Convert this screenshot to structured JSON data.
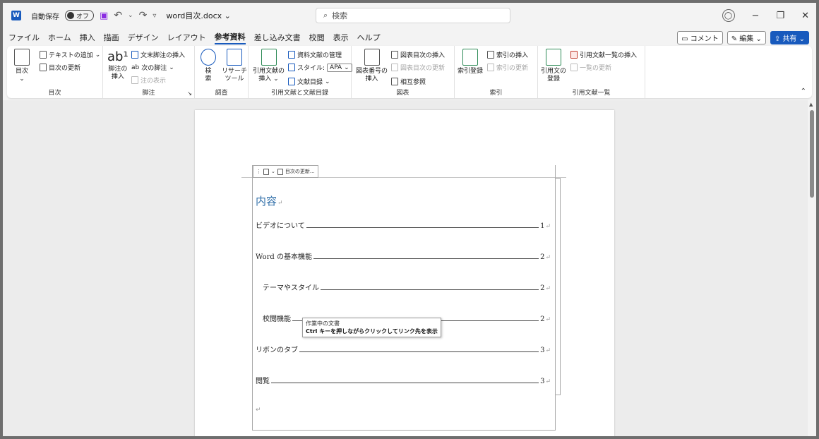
{
  "titlebar": {
    "app_icon": "word-icon",
    "autosave_label": "自動保存",
    "autosave_state": "オフ",
    "doc_title": "word目次.docx",
    "search_placeholder": "検索",
    "minimize_glyph": "−",
    "restore_glyph": "❐",
    "close_glyph": "✕"
  },
  "menu": {
    "tabs": [
      "ファイル",
      "ホーム",
      "挿入",
      "描画",
      "デザイン",
      "レイアウト",
      "参考資料",
      "差し込み文書",
      "校閲",
      "表示",
      "ヘルプ"
    ],
    "active_tab": "参考資料",
    "comment_label": "コメント",
    "edit_label": "編集",
    "share_label": "共有"
  },
  "ribbon": {
    "toc": {
      "big_label": "目次",
      "add_text": "テキストの追加",
      "update_toc": "目次の更新",
      "group": "目次"
    },
    "footnote": {
      "big_label_1": "脚注の",
      "big_label_2": "挿入",
      "endnote": "文末脚注の挿入",
      "next_footnote": "次の脚注",
      "show_notes": "注の表示",
      "group": "脚注"
    },
    "research": {
      "search_1": "検",
      "search_2": "索",
      "researcher_1": "リサーチ",
      "researcher_2": "ツール",
      "group": "調査"
    },
    "citations": {
      "big_label_1": "引用文献の",
      "big_label_2": "挿入",
      "manage_sources": "資料文献の管理",
      "style_label": "スタイル:",
      "style_value": "APA",
      "bibliography": "文献目録",
      "group": "引用文献と文献目録"
    },
    "captions": {
      "big_label_1": "図表番号の",
      "big_label_2": "挿入",
      "insert_tof": "図表目次の挿入",
      "update_tof": "図表目次の更新",
      "cross_ref": "相互参照",
      "group": "図表"
    },
    "index": {
      "big_label": "索引登録",
      "insert_index": "索引の挿入",
      "update_index": "索引の更新",
      "group": "索引"
    },
    "authorities": {
      "big_label_1": "引用文の",
      "big_label_2": "登録",
      "insert_toa": "引用文献一覧の挿入",
      "update_toa": "一覧の更新",
      "group": "引用文献一覧"
    }
  },
  "document": {
    "toc_tab_label": "目次の更新...",
    "heading": "内容",
    "entries": [
      {
        "text": "ビデオについて",
        "page": "1"
      },
      {
        "text": "Word の基本機能",
        "page": "2"
      },
      {
        "text": "テーマやスタイル",
        "page": "2"
      },
      {
        "text": "校閲機能",
        "page": "2"
      },
      {
        "text": "リボンのタブ",
        "page": "3"
      },
      {
        "text": "閲覧",
        "page": "3"
      }
    ],
    "para_mark": "↵"
  },
  "tooltip": {
    "line1": "作業中の文書",
    "line2": "Ctrl キーを押しながらクリックしてリンク先を表示"
  }
}
